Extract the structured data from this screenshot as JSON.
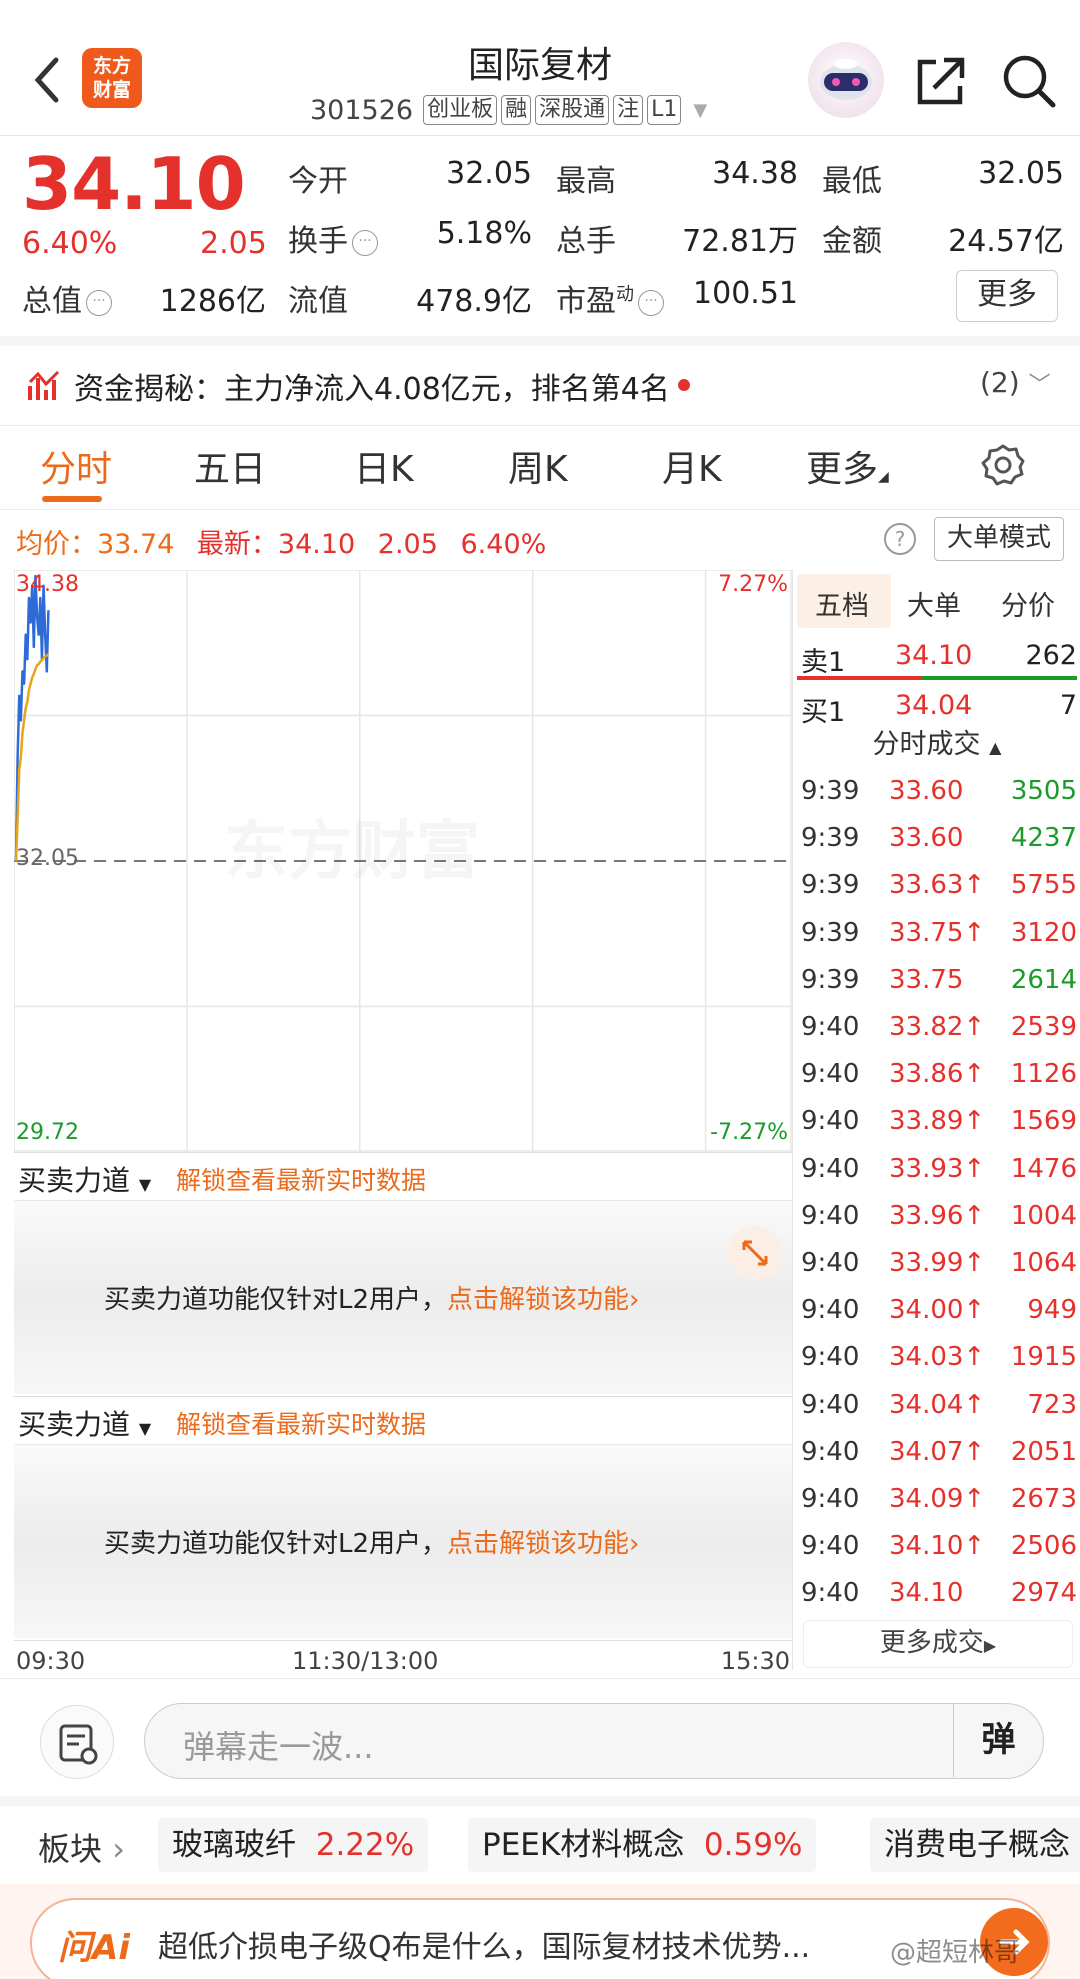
{
  "header": {
    "logo_text": "东方财富",
    "title": "国际复材",
    "code": "301526",
    "tags": [
      "创业板",
      "融",
      "深股通",
      "注",
      "L1"
    ]
  },
  "quote": {
    "price": "34.10",
    "change_pct": "6.40%",
    "change": "2.05",
    "fields": [
      {
        "label": "今开",
        "value": "32.05",
        "color": "normal"
      },
      {
        "label": "最高",
        "value": "34.38",
        "color": "red"
      },
      {
        "label": "最低",
        "value": "32.05",
        "color": "normal"
      },
      {
        "label": "换手",
        "value": "5.18%",
        "color": "normal"
      },
      {
        "label": "总手",
        "value": "72.81万",
        "color": "normal"
      },
      {
        "label": "金额",
        "value": "24.57亿",
        "color": "normal"
      },
      {
        "label": "总值",
        "value": "1286亿",
        "color": "normal"
      },
      {
        "label": "流值",
        "value": "478.9亿",
        "color": "normal"
      },
      {
        "label": "市盈",
        "value": "100.51",
        "color": "normal"
      }
    ],
    "pe_superscript": "动",
    "more_label": "更多"
  },
  "fund_flow": {
    "text": "资金揭秘：主力净流入4.08亿元，排名第4名",
    "count": "(2)"
  },
  "tabs": [
    "分时",
    "五日",
    "日K",
    "周K",
    "月K",
    "更多"
  ],
  "avg_line": {
    "avg_label": "均价：",
    "avg_value": "33.74",
    "latest_label": "最新：",
    "latest_value": "34.10",
    "change": "2.05",
    "change_pct": "6.40%",
    "help": "?",
    "mode_button": "大单模式"
  },
  "chart_data": {
    "type": "line",
    "title": "",
    "y_top_label": "34.38",
    "y_base_label": "32.05",
    "y_bottom_label": "29.72",
    "pct_top_label": "7.27%",
    "pct_bottom_label": "-7.27%",
    "ylim": [
      29.72,
      34.38
    ],
    "base": 32.05,
    "x_labels": [
      "09:30",
      "11:30/13:00",
      "15:30"
    ],
    "series": [
      {
        "color": "#2f6bd8",
        "x": [
          0,
          0.5,
          1,
          1.5,
          2,
          2.5,
          3,
          3.5,
          4,
          4.5,
          5,
          5.5,
          6,
          6.5,
          7,
          7.5,
          8,
          8.5,
          9,
          9.5,
          10
        ],
        "values": [
          32.05,
          32.9,
          33.4,
          33.2,
          33.6,
          33.5,
          33.9,
          33.7,
          34.2,
          34.0,
          34.3,
          33.8,
          34.38,
          34.05,
          33.9,
          34.2,
          33.7,
          34.3,
          33.9,
          33.6,
          34.1
        ]
      },
      {
        "color": "#e8a318",
        "x": [
          0,
          0.5,
          1,
          1.5,
          2,
          2.5,
          3,
          3.5,
          4,
          4.5,
          5,
          5.5,
          6,
          6.5,
          7,
          7.5,
          8,
          8.5,
          9,
          9.5,
          10
        ],
        "values": [
          32.05,
          32.4,
          32.8,
          32.9,
          33.1,
          33.2,
          33.3,
          33.35,
          33.45,
          33.5,
          33.55,
          33.58,
          33.62,
          33.65,
          33.66,
          33.68,
          33.69,
          33.71,
          33.72,
          33.73,
          33.74
        ]
      }
    ],
    "watermark": "东方财富"
  },
  "l2_panels": [
    {
      "select": "买卖力道",
      "unlock": "解锁查看最新实时数据",
      "msg_prefix": "买卖力道功能仅针对L2用户，",
      "msg_link": "点击解锁该功能"
    },
    {
      "select": "买卖力道",
      "unlock": "解锁查看最新实时数据",
      "msg_prefix": "买卖力道功能仅针对L2用户，",
      "msg_link": "点击解锁该功能"
    }
  ],
  "right_panel": {
    "tabs": [
      "五档",
      "大单",
      "分价"
    ],
    "sell1": {
      "label": "卖1",
      "price": "34.10",
      "vol": "262"
    },
    "buy1": {
      "label": "买1",
      "price": "34.04",
      "vol": "7"
    },
    "ticks_title": "分时成交",
    "ticks": [
      {
        "time": "9:39",
        "price": "33.60",
        "vol": "3505",
        "dir": "",
        "vcolor": "green"
      },
      {
        "time": "9:39",
        "price": "33.60",
        "vol": "4237",
        "dir": "",
        "vcolor": "green"
      },
      {
        "time": "9:39",
        "price": "33.63",
        "vol": "5755",
        "dir": "↑",
        "vcolor": "red"
      },
      {
        "time": "9:39",
        "price": "33.75",
        "vol": "3120",
        "dir": "↑",
        "vcolor": "red"
      },
      {
        "time": "9:39",
        "price": "33.75",
        "vol": "2614",
        "dir": "",
        "vcolor": "green"
      },
      {
        "time": "9:40",
        "price": "33.82",
        "vol": "2539",
        "dir": "↑",
        "vcolor": "red"
      },
      {
        "time": "9:40",
        "price": "33.86",
        "vol": "1126",
        "dir": "↑",
        "vcolor": "red"
      },
      {
        "time": "9:40",
        "price": "33.89",
        "vol": "1569",
        "dir": "↑",
        "vcolor": "red"
      },
      {
        "time": "9:40",
        "price": "33.93",
        "vol": "1476",
        "dir": "↑",
        "vcolor": "red"
      },
      {
        "time": "9:40",
        "price": "33.96",
        "vol": "1004",
        "dir": "↑",
        "vcolor": "red"
      },
      {
        "time": "9:40",
        "price": "33.99",
        "vol": "1064",
        "dir": "↑",
        "vcolor": "red"
      },
      {
        "time": "9:40",
        "price": "34.00",
        "vol": "949",
        "dir": "↑",
        "vcolor": "red"
      },
      {
        "time": "9:40",
        "price": "34.03",
        "vol": "1915",
        "dir": "↑",
        "vcolor": "red"
      },
      {
        "time": "9:40",
        "price": "34.04",
        "vol": "723",
        "dir": "↑",
        "vcolor": "red"
      },
      {
        "time": "9:40",
        "price": "34.07",
        "vol": "2051",
        "dir": "↑",
        "vcolor": "red"
      },
      {
        "time": "9:40",
        "price": "34.09",
        "vol": "2673",
        "dir": "↑",
        "vcolor": "red"
      },
      {
        "time": "9:40",
        "price": "34.10",
        "vol": "2506",
        "dir": "↑",
        "vcolor": "red"
      },
      {
        "time": "9:40",
        "price": "34.10",
        "vol": "2974",
        "dir": "",
        "vcolor": "red"
      }
    ],
    "more_ticks": "更多成交"
  },
  "danmu": {
    "placeholder": "弹幕走一波...",
    "button": "弹"
  },
  "sectors": {
    "label": "板块",
    "items": [
      {
        "name": "玻璃玻纤",
        "pct": "2.22%"
      },
      {
        "name": "PEEK材料概念",
        "pct": "0.59%"
      },
      {
        "name": "消费电子概念",
        "pct": ""
      }
    ]
  },
  "ai": {
    "logo": "问Ai",
    "question": "超低介损电子级Q布是什么，国际复材技术优势..."
  },
  "watermark": "@超短林哥",
  "colors": {
    "red": "#e5312c",
    "green": "#1a9b2a",
    "orange": "#ec6a1a",
    "line_blue": "#2f6bd8",
    "line_avg": "#e8a318"
  }
}
